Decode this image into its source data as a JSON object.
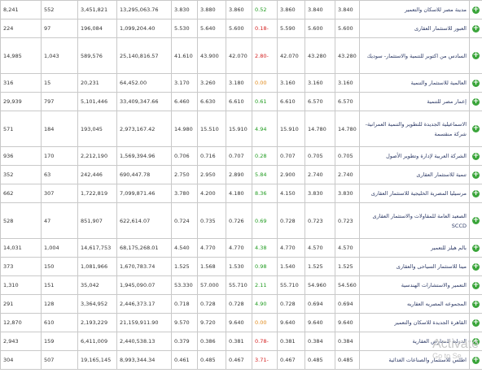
{
  "table": {
    "rows": [
      {
        "name": "مدينة مصر للاسكان والتعمير",
        "price": "3.840",
        "open": "3.840",
        "prev": "3.860",
        "change": "0.52",
        "high": "3.860",
        "low": "3.880",
        "last": "3.830",
        "value": "13,295,063.76",
        "volume": "3,451,821",
        "trades": "552",
        "extra": "8,241",
        "trend": "up"
      },
      {
        "name": "العبور للاستثمار العقارى",
        "price": "5.600",
        "open": "5.600",
        "prev": "5.590",
        "change": "0.18-",
        "high": "5.600",
        "low": "5.640",
        "last": "5.530",
        "value": "1,099,204.40",
        "volume": "196,084",
        "trades": "97",
        "extra": "224",
        "trend": "down"
      },
      {
        "name": "السادس من اكتوبر للتنمية والاستثمار- سوديك",
        "price": "43.280",
        "open": "43.280",
        "prev": "42.070",
        "change": "2.80-",
        "high": "42.070",
        "low": "43.900",
        "last": "41.610",
        "value": "25,140,816.57",
        "volume": "589,576",
        "trades": "1,043",
        "extra": "14,985",
        "trend": "down"
      },
      {
        "name": "العالمية للاستثمار والتنمية",
        "price": "3.160",
        "open": "3.160",
        "prev": "3.160",
        "change": "0.00",
        "high": "3.180",
        "low": "3.260",
        "last": "3.170",
        "value": "64,452.00",
        "volume": "20,231",
        "trades": "15",
        "extra": "316",
        "trend": "zero"
      },
      {
        "name": "إعمار مصر للتنمية",
        "price": "6.570",
        "open": "6.570",
        "prev": "6.610",
        "change": "0.61",
        "high": "6.610",
        "low": "6.630",
        "last": "6.460",
        "value": "33,409,347.66",
        "volume": "5,101,446",
        "trades": "797",
        "extra": "29,939",
        "trend": "up"
      },
      {
        "name": "الاسماعيلية الجديدة للتطوير والتنمية العمرانية-شركة منقسمة",
        "price": "14.780",
        "open": "14.780",
        "prev": "15.910",
        "change": "4.94",
        "high": "15.910",
        "low": "15.510",
        "last": "14.980",
        "value": "2,973,167.42",
        "volume": "193,045",
        "trades": "184",
        "extra": "571",
        "trend": "up"
      },
      {
        "name": "الشركة العربية لإدارة وتطوير الأصول",
        "price": "0.705",
        "open": "0.705",
        "prev": "0.707",
        "change": "0.28",
        "high": "0.707",
        "low": "0.716",
        "last": "0.706",
        "value": "1,569,394.96",
        "volume": "2,212,190",
        "trades": "170",
        "extra": "936",
        "trend": "up"
      },
      {
        "name": "تنمية للاستثمار العقارى",
        "price": "2.740",
        "open": "2.740",
        "prev": "2.900",
        "change": "5.84",
        "high": "2.890",
        "low": "2.950",
        "last": "2.750",
        "value": "690,447.78",
        "volume": "242,446",
        "trades": "63",
        "extra": "352",
        "trend": "up"
      },
      {
        "name": "مرسيليا المصرية الخليجية للاستثمار العقارى",
        "price": "3.830",
        "open": "3.830",
        "prev": "4.150",
        "change": "8.36",
        "high": "4.180",
        "low": "4.200",
        "last": "3.780",
        "value": "7,099,871.46",
        "volume": "1,722,819",
        "trades": "307",
        "extra": "662",
        "trend": "up"
      },
      {
        "name": "الصعيد العامة للمقاولات والاستثمار العقارى SCCD",
        "price": "0.723",
        "open": "0.723",
        "prev": "0.728",
        "change": "0.69",
        "high": "0.726",
        "low": "0.735",
        "last": "0.724",
        "value": "622,614.07",
        "volume": "851,907",
        "trades": "47",
        "extra": "528",
        "trend": "up"
      },
      {
        "name": "بالم هيلز للتعمير",
        "price": "4.570",
        "open": "4.570",
        "prev": "4.770",
        "change": "4.38",
        "high": "4.770",
        "low": "4.770",
        "last": "4.540",
        "value": "68,175,268.01",
        "volume": "14,617,753",
        "trades": "1,004",
        "extra": "14,031",
        "trend": "up"
      },
      {
        "name": "مينا للاستثمار السياحى والعقارى",
        "price": "1.525",
        "open": "1.525",
        "prev": "1.540",
        "change": "0.98",
        "high": "1.530",
        "low": "1.568",
        "last": "1.525",
        "value": "1,670,783.74",
        "volume": "1,081,966",
        "trades": "150",
        "extra": "373",
        "trend": "up"
      },
      {
        "name": "التعمير والاستشارات الهندسية",
        "price": "54.560",
        "open": "54.960",
        "prev": "55.710",
        "change": "2.11",
        "high": "55.710",
        "low": "57.000",
        "last": "53.330",
        "value": "1,945,090.07",
        "volume": "35,042",
        "trades": "151",
        "extra": "1,310",
        "trend": "up"
      },
      {
        "name": "المجموعه المصريه العقاريه",
        "price": "0.694",
        "open": "0.694",
        "prev": "0.728",
        "change": "4.90",
        "high": "0.728",
        "low": "0.728",
        "last": "0.718",
        "value": "2,446,373.17",
        "volume": "3,364,952",
        "trades": "128",
        "extra": "291",
        "trend": "up"
      },
      {
        "name": "القاهرة الجديدة للاسكان والتعمير",
        "price": "9.640",
        "open": "9.640",
        "prev": "9.640",
        "change": "0.00",
        "high": "9.640",
        "low": "9.720",
        "last": "9.570",
        "value": "21,159,911.90",
        "volume": "2,193,229",
        "trades": "610",
        "extra": "12,870",
        "trend": "zero"
      },
      {
        "name": "الدولية للمعارض العقارية",
        "price": "0.384",
        "open": "0.384",
        "prev": "0.381",
        "change": "0.78-",
        "high": "0.381",
        "low": "0.386",
        "last": "0.379",
        "value": "2,440,538.13",
        "volume": "6,411,009",
        "trades": "159",
        "extra": "2,943",
        "trend": "down"
      },
      {
        "name": "اطلس للاستثمار والصناعات الغذائية",
        "price": "0.485",
        "open": "0.485",
        "prev": "0.467",
        "change": "3.71-",
        "high": "0.467",
        "low": "0.485",
        "last": "0.461",
        "value": "8,993,344.34",
        "volume": "19,165,145",
        "trades": "507",
        "extra": "304",
        "trend": "down"
      }
    ]
  },
  "watermark": {
    "line1": "Activate",
    "line2": "Go to Se"
  },
  "icons": {
    "add": "plus-circle-icon"
  },
  "colors": {
    "up": "#1f9b1f",
    "down": "#d42020",
    "zero": "#e08a1a",
    "add_button": "#3aa53a"
  }
}
